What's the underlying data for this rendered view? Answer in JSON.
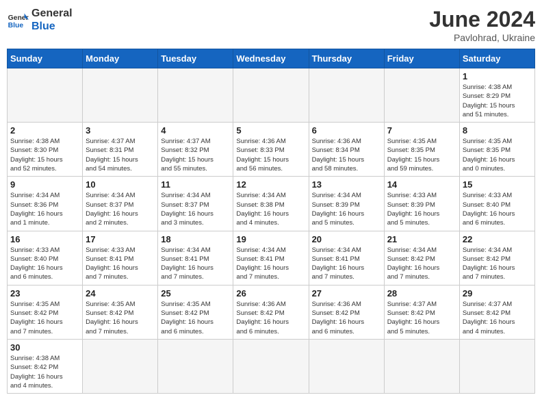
{
  "header": {
    "logo_general": "General",
    "logo_blue": "Blue",
    "month_title": "June 2024",
    "subtitle": "Pavlohrad, Ukraine"
  },
  "weekdays": [
    "Sunday",
    "Monday",
    "Tuesday",
    "Wednesday",
    "Thursday",
    "Friday",
    "Saturday"
  ],
  "weeks": [
    [
      {
        "day": "",
        "info": ""
      },
      {
        "day": "",
        "info": ""
      },
      {
        "day": "",
        "info": ""
      },
      {
        "day": "",
        "info": ""
      },
      {
        "day": "",
        "info": ""
      },
      {
        "day": "",
        "info": ""
      },
      {
        "day": "1",
        "info": "Sunrise: 4:38 AM\nSunset: 8:29 PM\nDaylight: 15 hours\nand 51 minutes."
      }
    ],
    [
      {
        "day": "2",
        "info": "Sunrise: 4:38 AM\nSunset: 8:30 PM\nDaylight: 15 hours\nand 52 minutes."
      },
      {
        "day": "3",
        "info": "Sunrise: 4:37 AM\nSunset: 8:31 PM\nDaylight: 15 hours\nand 54 minutes."
      },
      {
        "day": "4",
        "info": "Sunrise: 4:37 AM\nSunset: 8:32 PM\nDaylight: 15 hours\nand 55 minutes."
      },
      {
        "day": "5",
        "info": "Sunrise: 4:36 AM\nSunset: 8:33 PM\nDaylight: 15 hours\nand 56 minutes."
      },
      {
        "day": "6",
        "info": "Sunrise: 4:36 AM\nSunset: 8:34 PM\nDaylight: 15 hours\nand 58 minutes."
      },
      {
        "day": "7",
        "info": "Sunrise: 4:35 AM\nSunset: 8:35 PM\nDaylight: 15 hours\nand 59 minutes."
      },
      {
        "day": "8",
        "info": "Sunrise: 4:35 AM\nSunset: 8:35 PM\nDaylight: 16 hours\nand 0 minutes."
      }
    ],
    [
      {
        "day": "9",
        "info": "Sunrise: 4:34 AM\nSunset: 8:36 PM\nDaylight: 16 hours\nand 1 minute."
      },
      {
        "day": "10",
        "info": "Sunrise: 4:34 AM\nSunset: 8:37 PM\nDaylight: 16 hours\nand 2 minutes."
      },
      {
        "day": "11",
        "info": "Sunrise: 4:34 AM\nSunset: 8:37 PM\nDaylight: 16 hours\nand 3 minutes."
      },
      {
        "day": "12",
        "info": "Sunrise: 4:34 AM\nSunset: 8:38 PM\nDaylight: 16 hours\nand 4 minutes."
      },
      {
        "day": "13",
        "info": "Sunrise: 4:34 AM\nSunset: 8:39 PM\nDaylight: 16 hours\nand 5 minutes."
      },
      {
        "day": "14",
        "info": "Sunrise: 4:33 AM\nSunset: 8:39 PM\nDaylight: 16 hours\nand 5 minutes."
      },
      {
        "day": "15",
        "info": "Sunrise: 4:33 AM\nSunset: 8:40 PM\nDaylight: 16 hours\nand 6 minutes."
      }
    ],
    [
      {
        "day": "16",
        "info": "Sunrise: 4:33 AM\nSunset: 8:40 PM\nDaylight: 16 hours\nand 6 minutes."
      },
      {
        "day": "17",
        "info": "Sunrise: 4:33 AM\nSunset: 8:41 PM\nDaylight: 16 hours\nand 7 minutes."
      },
      {
        "day": "18",
        "info": "Sunrise: 4:34 AM\nSunset: 8:41 PM\nDaylight: 16 hours\nand 7 minutes."
      },
      {
        "day": "19",
        "info": "Sunrise: 4:34 AM\nSunset: 8:41 PM\nDaylight: 16 hours\nand 7 minutes."
      },
      {
        "day": "20",
        "info": "Sunrise: 4:34 AM\nSunset: 8:41 PM\nDaylight: 16 hours\nand 7 minutes."
      },
      {
        "day": "21",
        "info": "Sunrise: 4:34 AM\nSunset: 8:42 PM\nDaylight: 16 hours\nand 7 minutes."
      },
      {
        "day": "22",
        "info": "Sunrise: 4:34 AM\nSunset: 8:42 PM\nDaylight: 16 hours\nand 7 minutes."
      }
    ],
    [
      {
        "day": "23",
        "info": "Sunrise: 4:35 AM\nSunset: 8:42 PM\nDaylight: 16 hours\nand 7 minutes."
      },
      {
        "day": "24",
        "info": "Sunrise: 4:35 AM\nSunset: 8:42 PM\nDaylight: 16 hours\nand 7 minutes."
      },
      {
        "day": "25",
        "info": "Sunrise: 4:35 AM\nSunset: 8:42 PM\nDaylight: 16 hours\nand 6 minutes."
      },
      {
        "day": "26",
        "info": "Sunrise: 4:36 AM\nSunset: 8:42 PM\nDaylight: 16 hours\nand 6 minutes."
      },
      {
        "day": "27",
        "info": "Sunrise: 4:36 AM\nSunset: 8:42 PM\nDaylight: 16 hours\nand 6 minutes."
      },
      {
        "day": "28",
        "info": "Sunrise: 4:37 AM\nSunset: 8:42 PM\nDaylight: 16 hours\nand 5 minutes."
      },
      {
        "day": "29",
        "info": "Sunrise: 4:37 AM\nSunset: 8:42 PM\nDaylight: 16 hours\nand 4 minutes."
      }
    ],
    [
      {
        "day": "30",
        "info": "Sunrise: 4:38 AM\nSunset: 8:42 PM\nDaylight: 16 hours\nand 4 minutes."
      },
      {
        "day": "",
        "info": ""
      },
      {
        "day": "",
        "info": ""
      },
      {
        "day": "",
        "info": ""
      },
      {
        "day": "",
        "info": ""
      },
      {
        "day": "",
        "info": ""
      },
      {
        "day": "",
        "info": ""
      }
    ]
  ]
}
